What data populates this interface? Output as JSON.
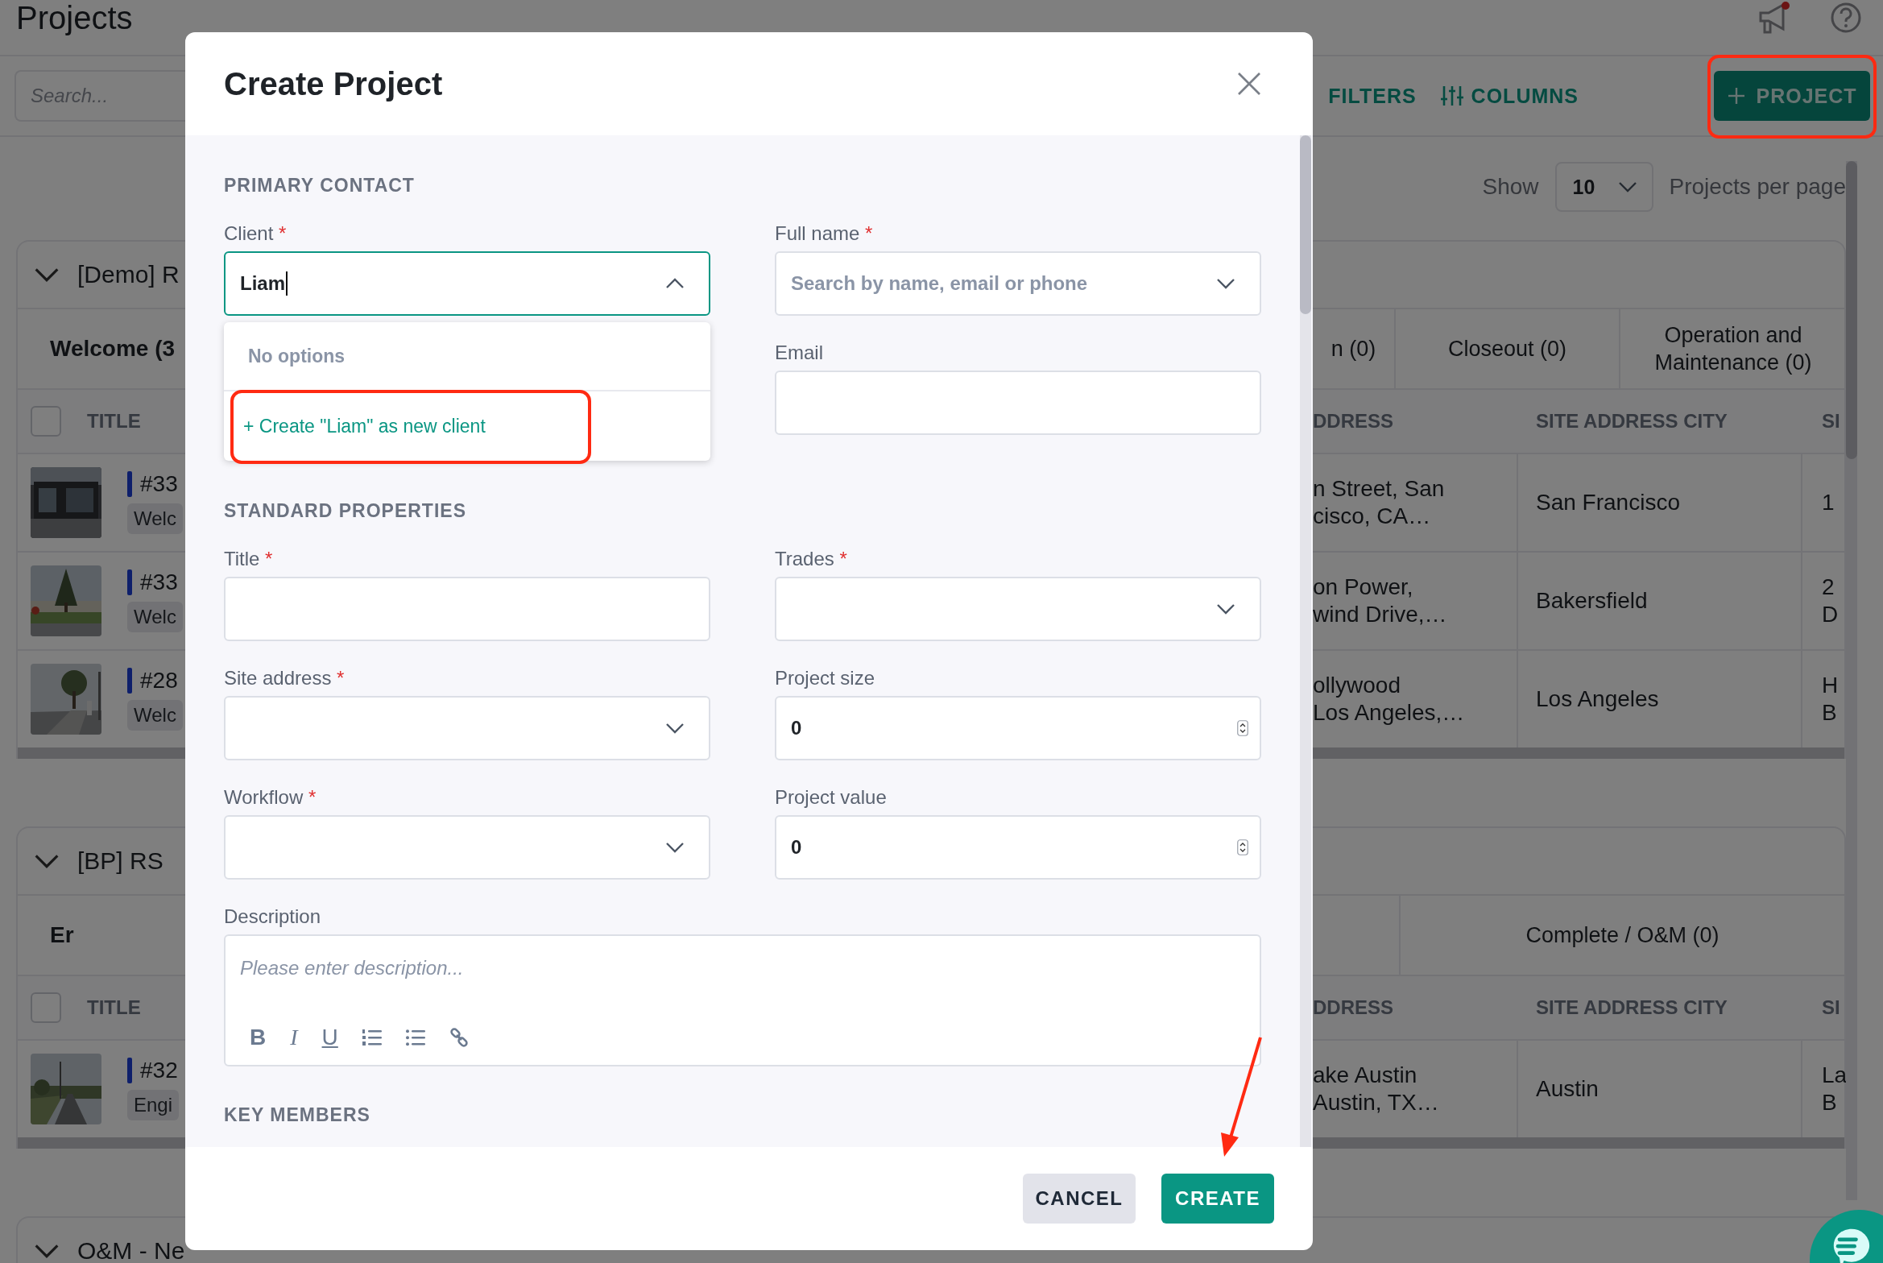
{
  "header": {
    "title": "Projects"
  },
  "toolbar": {
    "search_placeholder": "Search...",
    "filters": "FILTERS",
    "columns": "COLUMNS",
    "new_button": "PROJECT"
  },
  "pagination": {
    "label": "Show",
    "page_size": "10",
    "suffix": "Projects per page"
  },
  "groups": [
    {
      "name": "[Demo] R",
      "expanded": true,
      "stage_left": "Welcome (3",
      "stages_right": [
        "n (0)",
        "Closeout (0)",
        "Operation and Maintenance (0)"
      ],
      "select_all_checked": false,
      "title_column": "TITLE",
      "columns_right": [
        "DDRESS",
        "SITE ADDRESS CITY",
        "SI"
      ],
      "rows": [
        {
          "number": "#33",
          "tag": "Welc",
          "address_lines": [
            "n Street, San",
            "cisco, CA…"
          ],
          "city": "San Francisco",
          "column_3_lines": [
            "1"
          ]
        },
        {
          "number": "#33",
          "tag": "Welc",
          "address_lines": [
            "on Power,",
            "wind Drive,…"
          ],
          "city": "Bakersfield",
          "column_3_lines": [
            "2",
            "D"
          ]
        },
        {
          "number": "#28",
          "tag": "Welc",
          "address_lines": [
            "ollywood",
            "Los Angeles,…"
          ],
          "city": "Los Angeles",
          "column_3_lines": [
            "H",
            "B"
          ]
        }
      ]
    },
    {
      "name": "[BP] RS",
      "expanded": true,
      "stage_left": "Er",
      "stages_right": [
        "Complete / O&M (0)"
      ],
      "select_all_checked": false,
      "title_column": "TITLE",
      "columns_right": [
        "DDRESS",
        "SITE ADDRESS CITY",
        "SI"
      ],
      "rows": [
        {
          "number": "#32",
          "tag": "Engi",
          "address_lines": [
            "ake Austin",
            "Austin, TX…"
          ],
          "city": "Austin",
          "column_3_lines": [
            "La",
            "B"
          ]
        }
      ]
    },
    {
      "name": "O&M - Ne",
      "expanded": true
    }
  ],
  "modal": {
    "title": "Create Project",
    "sections": [
      {
        "title": "PRIMARY CONTACT",
        "columns": [
          [
            {
              "label": "Client",
              "required_mark": "*",
              "kind": "select",
              "value": "Liam",
              "expanded": true,
              "options_empty": "No options",
              "create_option": "+ Create \"Liam\" as new client"
            }
          ],
          [
            {
              "label": "Full name",
              "required_mark": "*",
              "kind": "select",
              "placeholder": "Search by name, email or phone",
              "expanded": false
            },
            {
              "label": "Email",
              "kind": "text"
            }
          ]
        ]
      },
      {
        "title": "STANDARD PROPERTIES",
        "columns": [
          [
            {
              "label": "Title",
              "required_mark": "*",
              "kind": "text"
            },
            {
              "label": "Site address",
              "required_mark": "*",
              "kind": "select",
              "expanded": false
            },
            {
              "label": "Workflow",
              "required_mark": "*",
              "kind": "select",
              "expanded": false
            }
          ],
          [
            {
              "label": "Trades",
              "required_mark": "*",
              "kind": "select",
              "expanded": false
            },
            {
              "label": "Project size",
              "kind": "number",
              "value": "0"
            },
            {
              "label": "Project value",
              "kind": "number",
              "value": "0"
            }
          ]
        ],
        "full": [
          {
            "label": "Description",
            "kind": "editor",
            "placeholder": "Please enter description...",
            "tools": [
              {
                "kind": "bold",
                "glyph": "B"
              },
              {
                "kind": "italic",
                "glyph": "I"
              },
              {
                "kind": "underline",
                "glyph": "U"
              },
              {
                "kind": "ordered-list"
              },
              {
                "kind": "bullet-list"
              },
              {
                "kind": "link"
              }
            ]
          }
        ]
      },
      {
        "title": "KEY MEMBERS"
      }
    ],
    "buttons": [
      {
        "label": "CANCEL",
        "kind": "secondary"
      },
      {
        "label": "CREATE",
        "kind": "primary"
      }
    ]
  }
}
